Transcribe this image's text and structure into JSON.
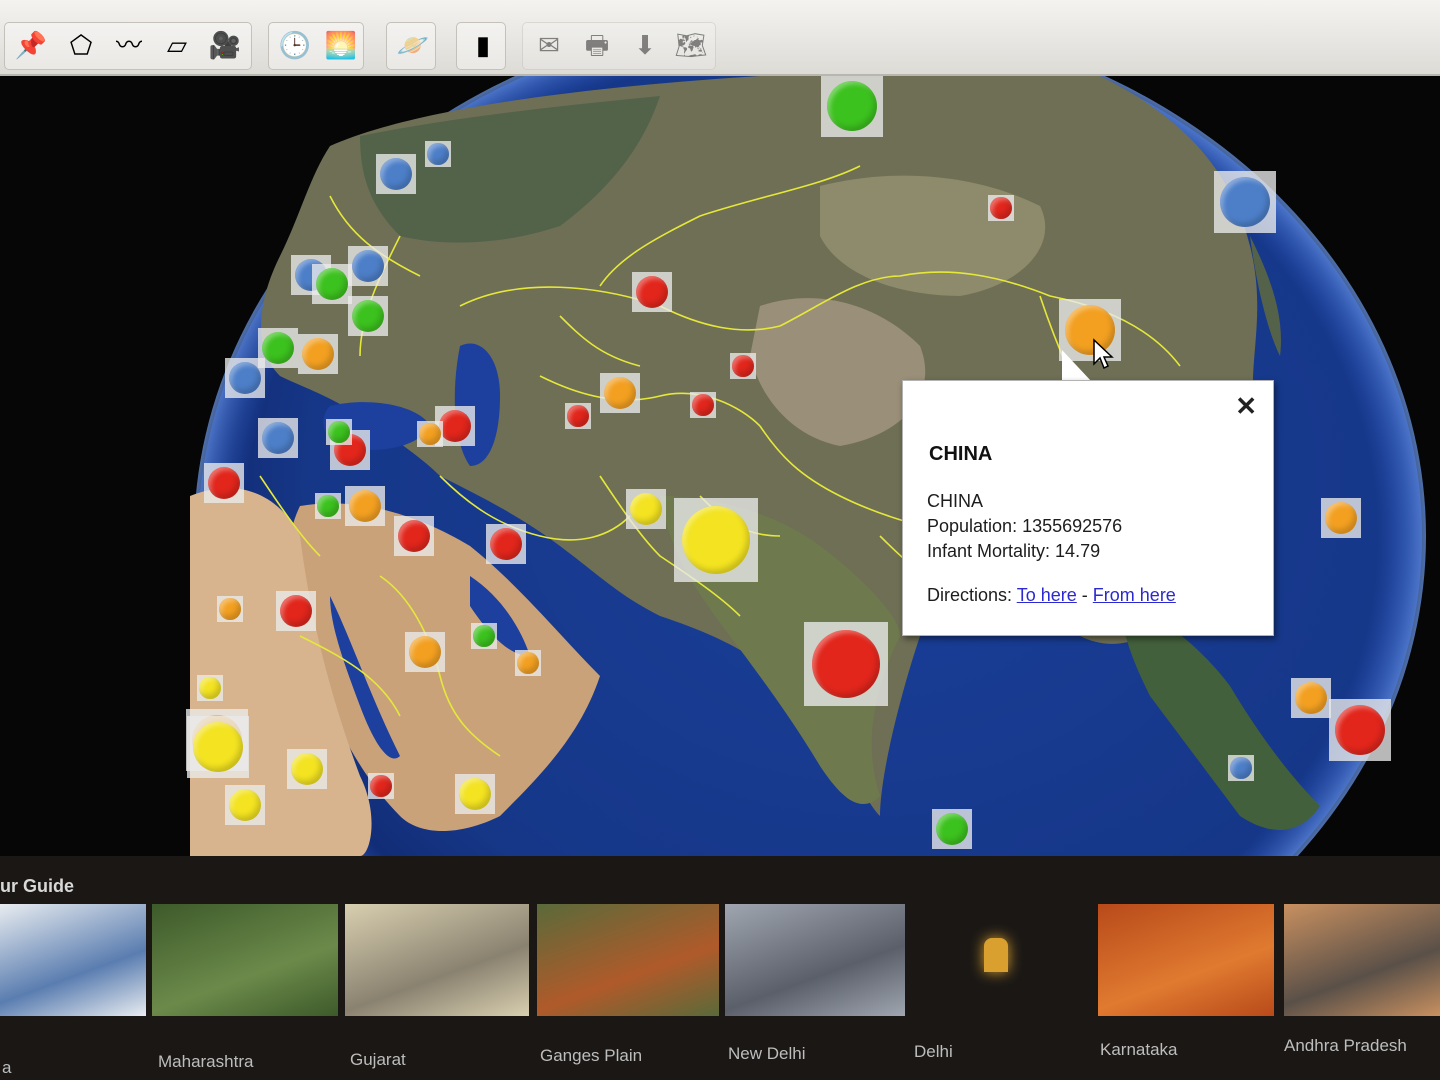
{
  "toolbar": {
    "buttons": [
      {
        "icon": "placemark-add-icon",
        "glyph": "📌",
        "enabled": true
      },
      {
        "icon": "polygon-add-icon",
        "glyph": "⬠",
        "enabled": true
      },
      {
        "icon": "path-add-icon",
        "glyph": "〰",
        "enabled": true
      },
      {
        "icon": "image-overlay-add-icon",
        "glyph": "▱",
        "enabled": true
      },
      {
        "icon": "record-tour-icon",
        "glyph": "🎥",
        "enabled": true
      },
      {
        "icon": "historical-imagery-icon",
        "glyph": "🕒",
        "enabled": true
      },
      {
        "icon": "sunlight-icon",
        "glyph": "🌅",
        "enabled": true
      },
      {
        "icon": "planets-icon",
        "glyph": "🪐",
        "enabled": true
      },
      {
        "icon": "ruler-icon",
        "glyph": "▮",
        "enabled": true
      },
      {
        "icon": "email-icon",
        "glyph": "✉",
        "enabled": false
      },
      {
        "icon": "print-icon",
        "glyph": "🖶",
        "enabled": false
      },
      {
        "icon": "save-image-icon",
        "glyph": "⬇",
        "enabled": false
      },
      {
        "icon": "view-in-maps-icon",
        "glyph": "🗺",
        "enabled": false
      }
    ]
  },
  "colors": {
    "red": "#e2261c",
    "orange": "#f3a021",
    "yellow": "#f3e321",
    "green": "#3cc21e",
    "blue": "#4d7fc9",
    "border_lines": "#e5e83a",
    "link": "#2a2ad0"
  },
  "markers": [
    {
      "color": "green",
      "size": "large"
    },
    {
      "color": "blue",
      "size": "large"
    },
    {
      "color": "red",
      "size": "small"
    },
    {
      "color": "orange",
      "size": "large"
    },
    {
      "color": "red",
      "size": "medium"
    },
    {
      "color": "orange",
      "size": "medium"
    },
    {
      "color": "red",
      "size": "small"
    },
    {
      "color": "red",
      "size": "small"
    },
    {
      "color": "red",
      "size": "small"
    },
    {
      "color": "yellow",
      "size": "medium"
    },
    {
      "color": "yellow",
      "size": "xlarge"
    },
    {
      "color": "red",
      "size": "xlarge"
    },
    {
      "color": "red",
      "size": "medium"
    },
    {
      "color": "red",
      "size": "medium"
    },
    {
      "color": "red",
      "size": "medium"
    },
    {
      "color": "red",
      "size": "medium"
    },
    {
      "color": "orange",
      "size": "medium"
    },
    {
      "color": "orange",
      "size": "medium"
    },
    {
      "color": "orange",
      "size": "large"
    },
    {
      "color": "green",
      "size": "small"
    },
    {
      "color": "orange",
      "size": "small"
    },
    {
      "color": "yellow",
      "size": "medium"
    },
    {
      "color": "yellow",
      "size": "large"
    },
    {
      "color": "yellow",
      "size": "medium"
    },
    {
      "color": "red",
      "size": "small"
    },
    {
      "color": "yellow",
      "size": "medium"
    },
    {
      "color": "green",
      "size": "medium"
    },
    {
      "color": "red",
      "size": "medium"
    },
    {
      "color": "blue",
      "size": "medium"
    },
    {
      "color": "blue",
      "size": "small"
    },
    {
      "color": "blue",
      "size": "medium"
    },
    {
      "color": "green",
      "size": "medium"
    },
    {
      "color": "blue",
      "size": "medium"
    },
    {
      "color": "green",
      "size": "medium"
    },
    {
      "color": "orange",
      "size": "medium"
    },
    {
      "color": "blue",
      "size": "medium"
    },
    {
      "color": "blue",
      "size": "medium"
    },
    {
      "color": "green",
      "size": "small"
    },
    {
      "color": "red",
      "size": "medium"
    },
    {
      "color": "orange",
      "size": "small"
    },
    {
      "color": "green",
      "size": "small"
    },
    {
      "color": "orange",
      "size": "small"
    },
    {
      "color": "orange",
      "size": "medium"
    },
    {
      "color": "red",
      "size": "large"
    },
    {
      "color": "orange",
      "size": "medium"
    },
    {
      "color": "blue",
      "size": "small"
    },
    {
      "color": "green",
      "size": "medium"
    },
    {
      "color": "yellow",
      "size": "small"
    }
  ],
  "popup": {
    "title": "CHINA",
    "name": "CHINA",
    "population": "Population: 1355692576",
    "infant_mortality": "Infant Mortality: 14.79",
    "directions_label": "Directions:",
    "to_here": "To here",
    "separator": "-",
    "from_here": "From here",
    "close_glyph": "✕"
  },
  "tour": {
    "label": "ur Guide",
    "items": [
      {
        "caption": "a",
        "colors": [
          "#5a7db0",
          "#e8ecf0"
        ]
      },
      {
        "caption": "Maharashtra",
        "colors": [
          "#6b8a4a",
          "#3d5a2a"
        ]
      },
      {
        "caption": "Gujarat",
        "colors": [
          "#8a8270",
          "#d8cfb0"
        ]
      },
      {
        "caption": "Ganges Plain",
        "colors": [
          "#b05a2a",
          "#5a6a3a"
        ]
      },
      {
        "caption": "New Delhi",
        "colors": [
          "#5a5f6a",
          "#a0a6b0"
        ]
      },
      {
        "caption": "Delhi",
        "colors": [
          "#1a1a1a",
          "#d9a030"
        ]
      },
      {
        "caption": "Karnataka",
        "colors": [
          "#e07a30",
          "#b84a1a"
        ]
      },
      {
        "caption": "Andhra Pradesh",
        "colors": [
          "#5a5048",
          "#c89060"
        ]
      }
    ]
  }
}
